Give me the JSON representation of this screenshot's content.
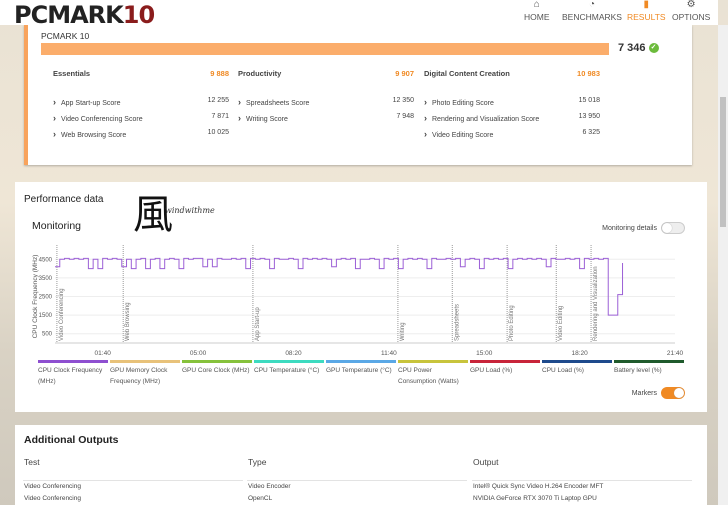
{
  "header": {
    "logo": "PCMARK",
    "logo_num": "10",
    "nav": [
      {
        "label": "HOME",
        "icon": "home-icon"
      },
      {
        "label": "BENCHMARKS",
        "icon": "gauge-icon"
      },
      {
        "label": "RESULTS",
        "icon": "bar-chart-icon",
        "active": true
      },
      {
        "label": "OPTIONS",
        "icon": "gear-icon"
      }
    ]
  },
  "summary": {
    "title": "PCMARK 10",
    "total": "7 346",
    "bar_fill": 1.0,
    "groups": [
      {
        "name": "Essentials",
        "score": "9 888",
        "items": [
          {
            "name": "App Start-up Score",
            "score": "12 255"
          },
          {
            "name": "Video Conferencing Score",
            "score": "7 871"
          },
          {
            "name": "Web Browsing Score",
            "score": "10 025"
          }
        ]
      },
      {
        "name": "Productivity",
        "score": "9 907",
        "items": [
          {
            "name": "Spreadsheets Score",
            "score": "12 350"
          },
          {
            "name": "Writing Score",
            "score": "7 948"
          }
        ]
      },
      {
        "name": "Digital Content Creation",
        "score": "10 983",
        "items": [
          {
            "name": "Photo Editing Score",
            "score": "15 018"
          },
          {
            "name": "Rendering and Visualization Score",
            "score": "13 950"
          },
          {
            "name": "Video Editing Score",
            "score": "6 325"
          }
        ]
      }
    ]
  },
  "performance": {
    "title": "Performance data",
    "monitoring": "Monitoring",
    "monitoring_details": "Monitoring details",
    "markers_label": "Markers",
    "watermark": "風",
    "watermark_text": "windwithme"
  },
  "chart_data": {
    "type": "line",
    "ylabel": "CPU Clock Frequency (MHz)",
    "yticks": [
      500,
      1500,
      2500,
      3500,
      4500
    ],
    "ylim": [
      0,
      5000
    ],
    "xlim_s": [
      0,
      1300
    ],
    "xticks": [
      "01:40",
      "05:00",
      "08:20",
      "11:40",
      "15:00",
      "18:20",
      "21:40"
    ],
    "markers": [
      {
        "label": "Video Conferencing",
        "t": 4
      },
      {
        "label": "Web Browsing",
        "t": 143
      },
      {
        "label": "App Start-up",
        "t": 415
      },
      {
        "label": "Writing",
        "t": 719
      },
      {
        "label": "Spreadsheets",
        "t": 833
      },
      {
        "label": "Photo Editing",
        "t": 948
      },
      {
        "label": "Video Editing",
        "t": 1051
      },
      {
        "label": "Rendering and Visualization",
        "t": 1124
      }
    ],
    "series": [
      {
        "name": "CPU Clock Frequency (MHz)",
        "color": "#9b5fd6",
        "step_s": 10,
        "values": [
          4100,
          4500,
          4550,
          4500,
          4550,
          4500,
          4550,
          4000,
          4500,
          4000,
          4550,
          4500,
          4550,
          4500,
          4100,
          4500,
          4000,
          4500,
          4550,
          4000,
          4500,
          4550,
          4000,
          4500,
          4550,
          4500,
          4000,
          4550,
          4500,
          4550,
          4550,
          4100,
          4500,
          4100,
          4550,
          4500,
          4500,
          4550,
          4500,
          4550,
          4000,
          4550,
          4500,
          4550,
          4500,
          4000,
          4550,
          4500,
          4500,
          4550,
          4500,
          4000,
          4550,
          4500,
          4550,
          4500,
          4550,
          4500,
          4100,
          4500,
          4550,
          4500,
          4550,
          4000,
          4500,
          4500,
          4550,
          4500,
          4000,
          4550,
          4500,
          4550,
          4000,
          4500,
          4550,
          4500,
          4550,
          4500,
          4000,
          4550,
          4500,
          4500,
          4550,
          4500,
          4550,
          4100,
          4500,
          4550,
          4500,
          4000,
          4550,
          4500,
          4550,
          4500,
          4550,
          4000,
          4500,
          4550,
          4500,
          4550,
          4500,
          4550,
          4500,
          4100,
          4550,
          4500,
          4500,
          4550,
          4500,
          4550,
          4000,
          4550,
          4500,
          4550,
          4500,
          4550,
          1500,
          1500,
          2600,
          4300
        ]
      }
    ]
  },
  "legend": [
    {
      "label": "CPU Clock Frequency (MHz)",
      "color": "#8e4fd0"
    },
    {
      "label": "GPU Memory Clock Frequency (MHz)",
      "color": "#e8c27a"
    },
    {
      "label": "GPU Core Clock (MHz)",
      "color": "#86c23c"
    },
    {
      "label": "CPU Temperature (°C)",
      "color": "#3ddbc0"
    },
    {
      "label": "GPU Temperature (°C)",
      "color": "#5aa8e6"
    },
    {
      "label": "CPU Power Consumption (Watts)",
      "color": "#c8c43c"
    },
    {
      "label": "GPU Load (%)",
      "color": "#c8243a"
    },
    {
      "label": "CPU Load (%)",
      "color": "#1e4a8c"
    },
    {
      "label": "Battery level (%)",
      "color": "#1f5a2c"
    }
  ],
  "outputs": {
    "title": "Additional Outputs",
    "headers": [
      "Test",
      "Type",
      "Output"
    ],
    "rows": [
      [
        "Video Conferencing",
        "Video Encoder",
        "Intel® Quick Sync Video H.264 Encoder MFT"
      ],
      [
        "Video Conferencing",
        "OpenCL",
        "NVIDIA GeForce RTX 3070 Ti Laptop GPU"
      ]
    ]
  }
}
